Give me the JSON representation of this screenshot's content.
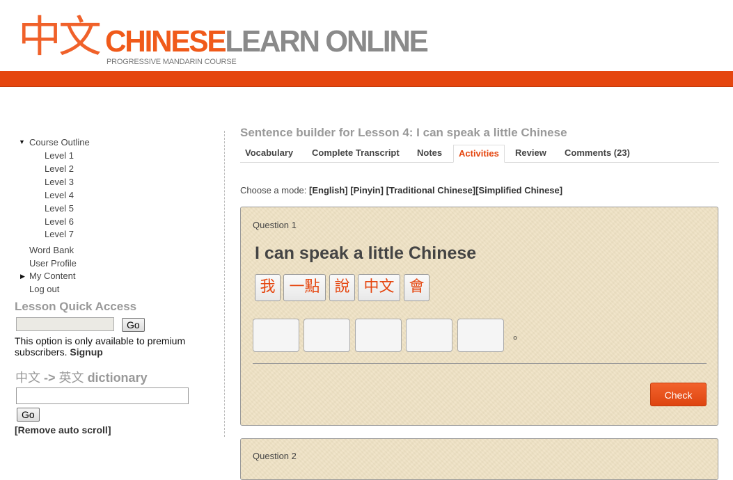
{
  "header": {
    "logo_chinese": "中文",
    "logo_title_part1": "CHINESE",
    "logo_title_part2": "LEARN ONLINE",
    "logo_subtitle": "PROGRESSIVE MANDARIN COURSE",
    "accent_color": "#e5460f"
  },
  "sidebar": {
    "course_outline": {
      "label": "Course Outline",
      "expanded": true,
      "levels": [
        "Level 1",
        "Level 2",
        "Level 3",
        "Level 4",
        "Level 5",
        "Level 6",
        "Level 7"
      ]
    },
    "links": {
      "word_bank": "Word Bank",
      "user_profile": "User Profile",
      "my_content": "My Content",
      "log_out": "Log out"
    },
    "quick_access": {
      "title": "Lesson Quick Access",
      "input_value": "",
      "go_label": "Go",
      "note": "This option is only available to premium subscribers.",
      "signup_label": "Signup"
    },
    "dictionary": {
      "title_cn1": "中文",
      "title_arrow": "->",
      "title_cn2": "英文",
      "title_en": "dictionary",
      "input_value": "",
      "go_label": "Go"
    },
    "remove_auto_scroll": "[Remove auto scroll]"
  },
  "main": {
    "page_title": "Sentence builder for Lesson 4: I can speak a little Chinese",
    "tabs": [
      {
        "label": "Vocabulary",
        "active": false
      },
      {
        "label": "Complete Transcript",
        "active": false
      },
      {
        "label": "Notes",
        "active": false
      },
      {
        "label": "Activities",
        "active": true
      },
      {
        "label": "Review",
        "active": false
      },
      {
        "label": "Comments (23)",
        "active": false
      }
    ],
    "mode": {
      "prefix": "Choose a mode:",
      "options": [
        "[English]",
        "[Pinyin]",
        "[Traditional Chinese]",
        "[Simplified Chinese]"
      ]
    },
    "questions": [
      {
        "label": "Question 1",
        "sentence": "I can speak a little Chinese",
        "word_chips": [
          "我",
          "一點",
          "說",
          "中文",
          "會"
        ],
        "answer_slots": [
          "",
          "",
          "",
          "",
          ""
        ],
        "terminal_punctuation": "。",
        "check_label": "Check"
      },
      {
        "label": "Question 2"
      }
    ]
  }
}
